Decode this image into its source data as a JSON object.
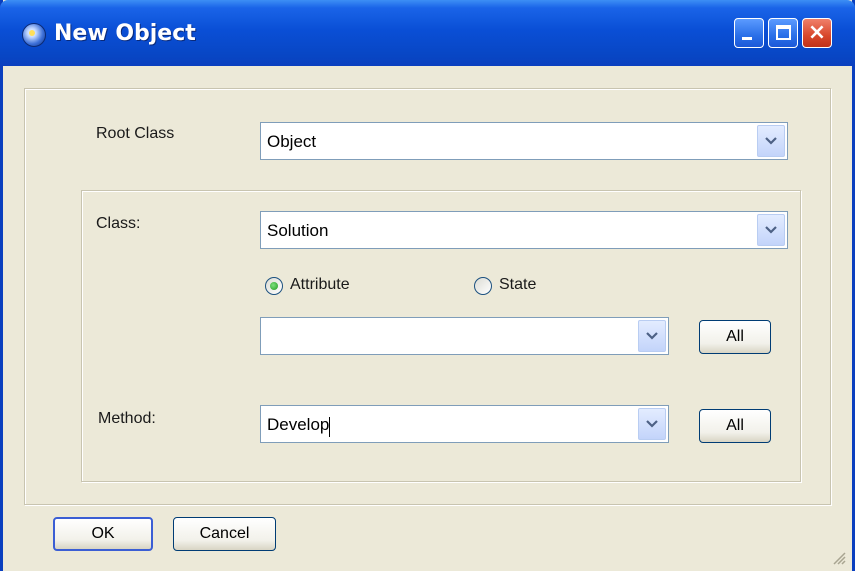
{
  "window": {
    "title": "New Object",
    "icon": "app-globe-icon"
  },
  "root_class": {
    "label": "Root Class",
    "value": "Object"
  },
  "class": {
    "label": "Class:",
    "value": "Solution"
  },
  "mode": {
    "options": [
      {
        "label": "Attribute",
        "selected": true
      },
      {
        "label": "State",
        "selected": false
      }
    ]
  },
  "attribute": {
    "value": "",
    "all_label": "All"
  },
  "method": {
    "label": "Method:",
    "value": "Develop",
    "all_label": "All"
  },
  "buttons": {
    "ok_label": "OK",
    "cancel_label": "Cancel"
  },
  "colors": {
    "titlebar": "#0a4fd6",
    "dialog_bg": "#ece9d8",
    "close": "#d8472b"
  }
}
